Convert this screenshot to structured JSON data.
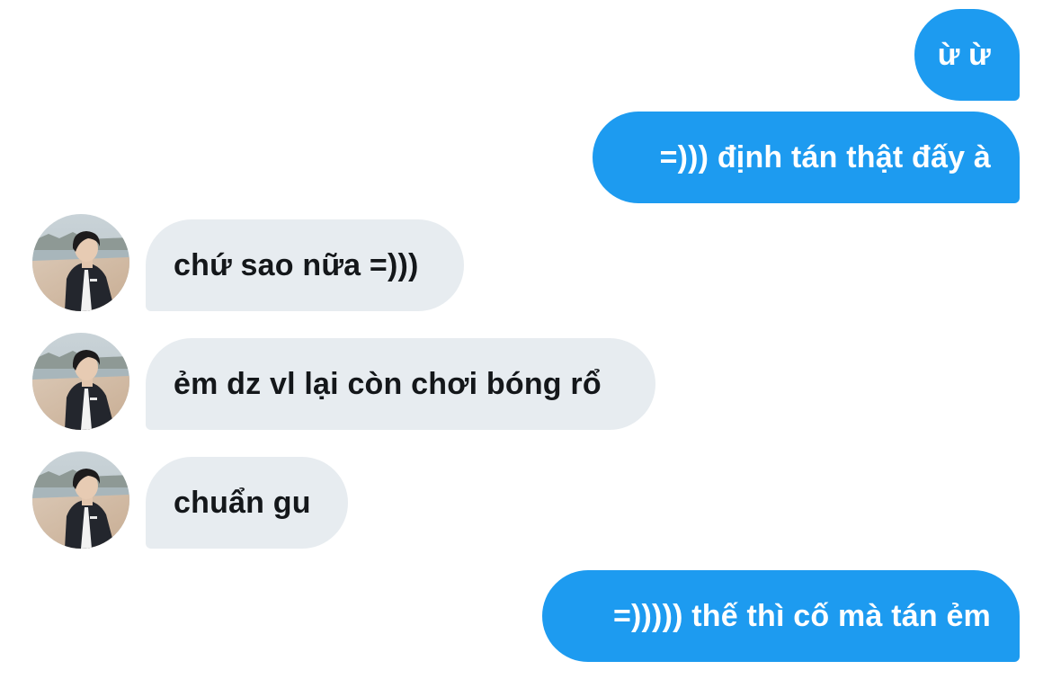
{
  "conversation": {
    "messages": [
      {
        "direction": "outgoing",
        "text": "ừ ừ"
      },
      {
        "direction": "outgoing",
        "text": "=))) định tán thật đấy à"
      },
      {
        "direction": "incoming",
        "text": "chứ sao nữa =)))"
      },
      {
        "direction": "incoming",
        "text": "ẻm dz vl lại còn chơi bóng rổ"
      },
      {
        "direction": "incoming",
        "text": "chuẩn gu"
      },
      {
        "direction": "outgoing",
        "text": "=))))) thế thì cố mà tán ẻm"
      }
    ]
  },
  "colors": {
    "outgoing_bubble": "#1d9bf0",
    "incoming_bubble": "#e7ecf0",
    "background": "#ffffff"
  },
  "icons": {
    "avatar": "profile-photo-avatar"
  }
}
